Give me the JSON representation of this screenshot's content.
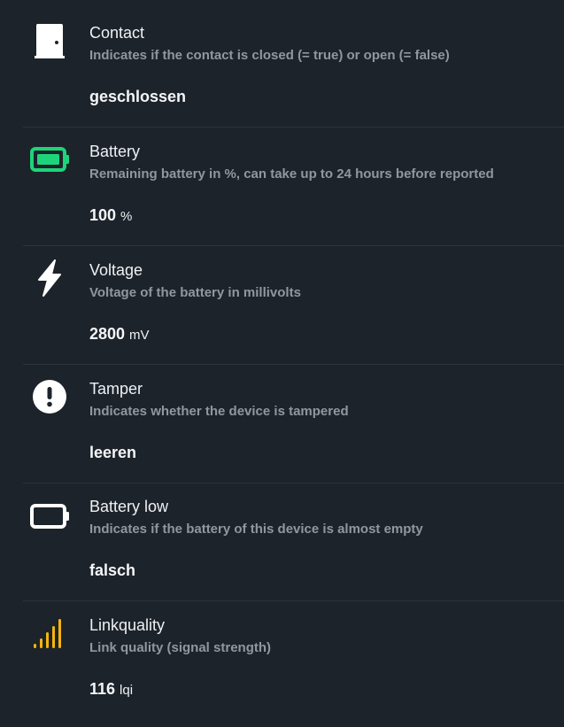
{
  "colors": {
    "background": "#1d232a",
    "title": "#eef1f4",
    "description": "#8f97a1",
    "battery_ok": "#1ed47a",
    "linkquality": "#f5b50f",
    "icon_default": "#ffffff"
  },
  "items": [
    {
      "icon": "door-icon",
      "title": "Contact",
      "description": "Indicates if the contact is closed (= true) or open (= false)",
      "value": "geschlossen",
      "unit": ""
    },
    {
      "icon": "battery-full-icon",
      "title": "Battery",
      "description": "Remaining battery in %, can take up to 24 hours before reported",
      "value": "100",
      "unit": "%"
    },
    {
      "icon": "bolt-icon",
      "title": "Voltage",
      "description": "Voltage of the battery in millivolts",
      "value": "2800",
      "unit": "mV"
    },
    {
      "icon": "exclamation-circle-icon",
      "title": "Tamper",
      "description": "Indicates whether the device is tampered",
      "value": "leeren",
      "unit": ""
    },
    {
      "icon": "battery-empty-icon",
      "title": "Battery low",
      "description": "Indicates if the battery of this device is almost empty",
      "value": "falsch",
      "unit": ""
    },
    {
      "icon": "signal-icon",
      "title": "Linkquality",
      "description": "Link quality (signal strength)",
      "value": "116",
      "unit": "lqi"
    }
  ]
}
